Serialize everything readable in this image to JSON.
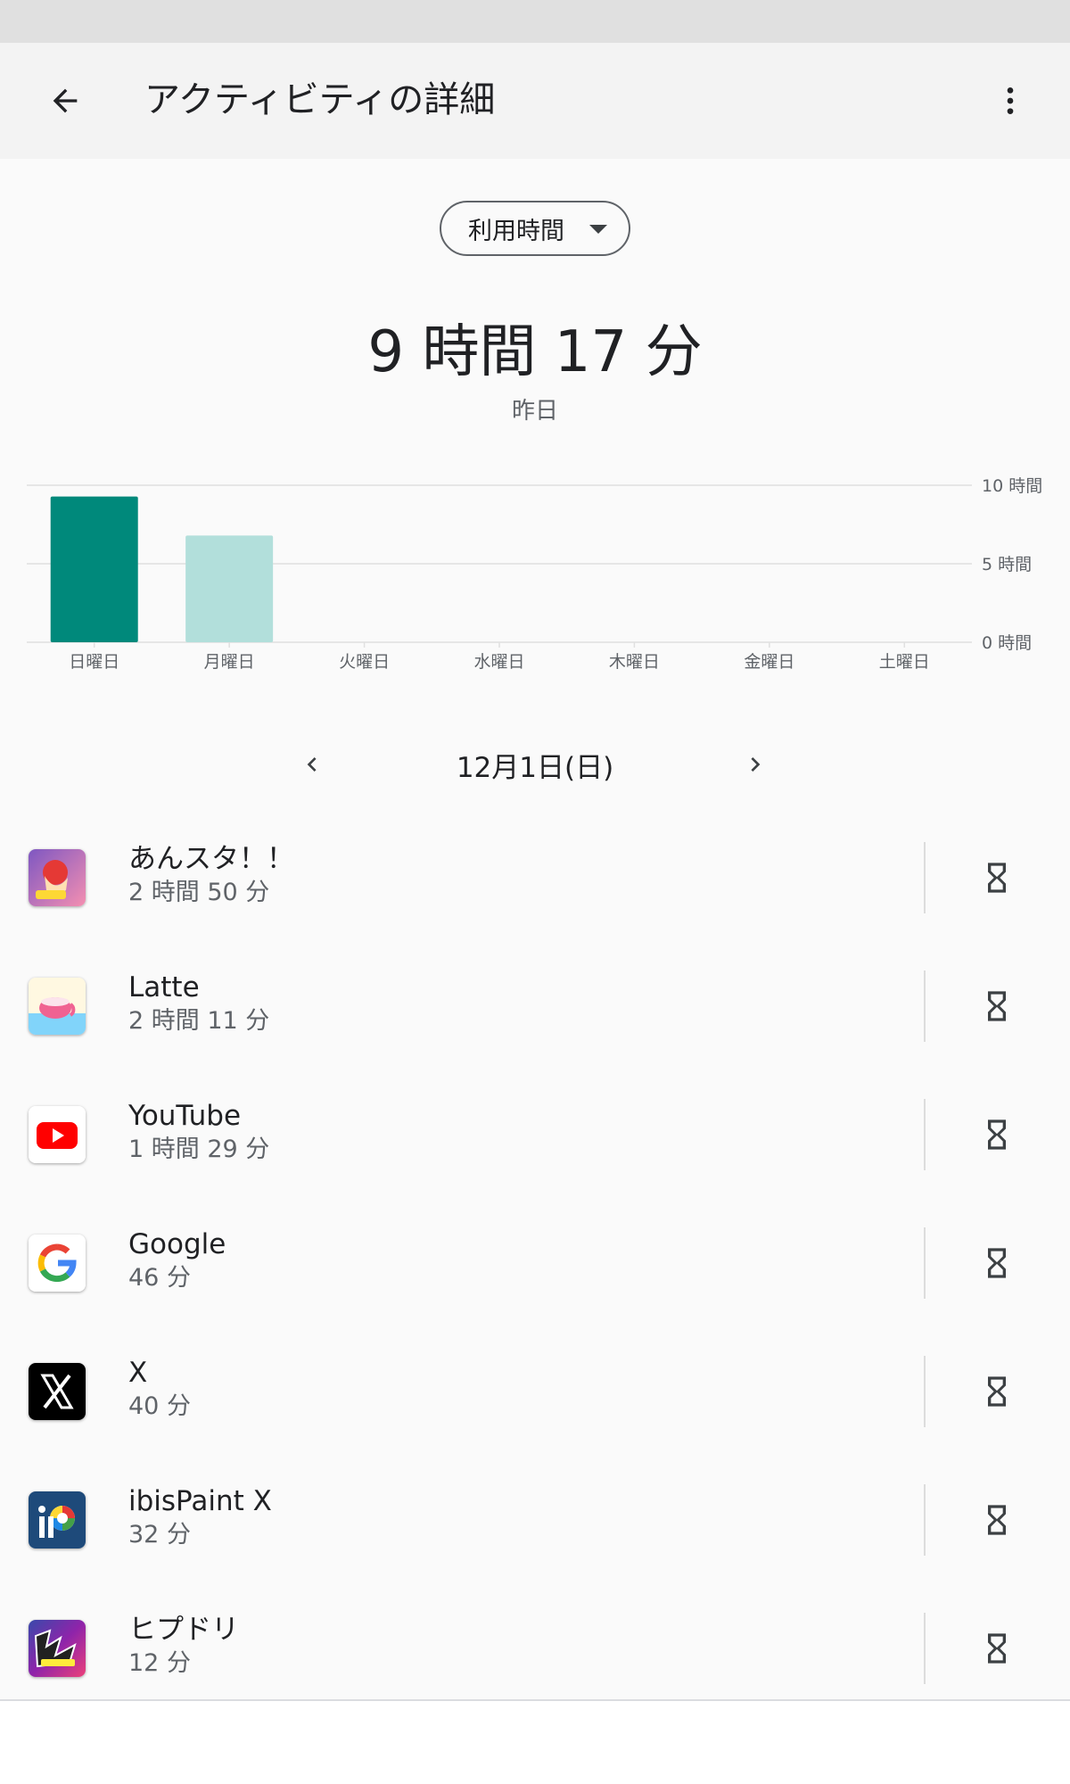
{
  "header": {
    "title": "アクティビティの詳細",
    "back_icon": "arrow-back-icon",
    "menu_icon": "more-vert-icon"
  },
  "metric_selector": {
    "selected": "利用時間"
  },
  "summary": {
    "total": "9 時間 17 分",
    "period": "昨日"
  },
  "chart_data": {
    "type": "bar",
    "categories": [
      "日曜日",
      "月曜日",
      "火曜日",
      "水曜日",
      "木曜日",
      "金曜日",
      "土曜日"
    ],
    "values": [
      9.28,
      6.8,
      0,
      0,
      0,
      0,
      0
    ],
    "y_tick_labels": [
      "10 時間",
      "5 時間",
      "0 時間"
    ],
    "y_ticks": [
      10,
      5,
      0
    ],
    "ylim": [
      0,
      10
    ],
    "grid": true,
    "highlighted_index": 0,
    "colors": {
      "highlight": "#00897b",
      "normal": "#b2dfdb",
      "grid": "#e0e0e0",
      "label": "#5f6368"
    }
  },
  "date_nav": {
    "label": "12月1日(日)",
    "prev_icon": "chevron-left-icon",
    "next_icon": "chevron-right-icon"
  },
  "apps": [
    {
      "name": "あんスタ！！",
      "time": "2 時間 50 分",
      "icon": "ensemble-stars-icon"
    },
    {
      "name": "Latte",
      "time": "2 時間 11 分",
      "icon": "latte-icon"
    },
    {
      "name": "YouTube",
      "time": "1 時間 29 分",
      "icon": "youtube-icon"
    },
    {
      "name": "Google",
      "time": "46 分",
      "icon": "google-icon"
    },
    {
      "name": "X",
      "time": "40 分",
      "icon": "x-icon"
    },
    {
      "name": "ibisPaint X",
      "time": "32 分",
      "icon": "ibispaint-icon"
    },
    {
      "name": "ヒプドリ",
      "time": "12 分",
      "icon": "hypdri-icon"
    }
  ],
  "timer_icon": "hourglass-icon"
}
